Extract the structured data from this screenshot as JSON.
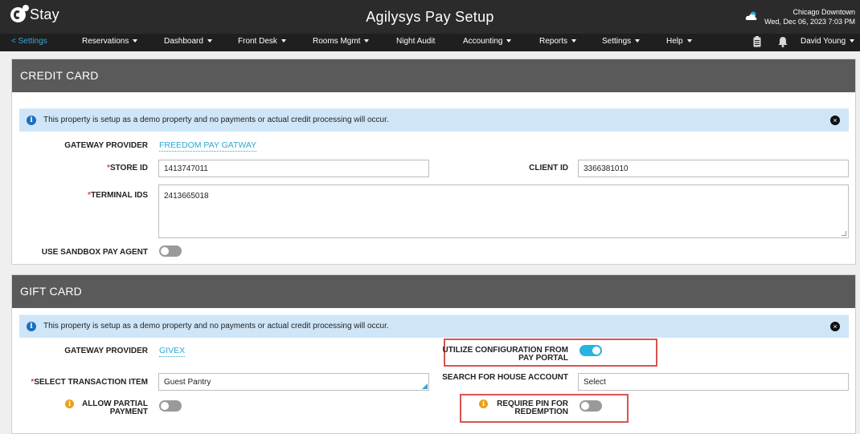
{
  "brand": {
    "logo_text": "Stay"
  },
  "header": {
    "title": "Agilysys Pay Setup",
    "location": "Chicago Downtown",
    "datetime": "Wed, Dec 06, 2023 7:03 PM"
  },
  "nav": {
    "back_label": "< Settings",
    "items": [
      {
        "label": "Reservations"
      },
      {
        "label": "Dashboard"
      },
      {
        "label": "Front Desk"
      },
      {
        "label": "Rooms Mgmt"
      },
      {
        "label": "Night Audit"
      },
      {
        "label": "Accounting"
      },
      {
        "label": "Reports"
      },
      {
        "label": "Settings"
      },
      {
        "label": "Help"
      }
    ],
    "user": "David Young"
  },
  "credit_card": {
    "title": "CREDIT CARD",
    "info": "This property is setup as a demo property and no payments or actual credit processing will occur.",
    "gateway_label": "GATEWAY PROVIDER",
    "gateway_value": "FREEDOM PAY GATWAY",
    "store_id_label": "STORE ID",
    "store_id_value": "1413747011",
    "client_id_label": "CLIENT ID",
    "client_id_value": "3366381010",
    "terminal_label": "TERMINAL IDS",
    "terminal_value": "2413665018",
    "sandbox_label": "USE SANDBOX PAY AGENT",
    "sandbox_on": false
  },
  "gift_card": {
    "title": "GIFT CARD",
    "info": "This property is setup as a demo property and no payments or actual credit processing will occur.",
    "gateway_label": "GATEWAY PROVIDER",
    "gateway_value": "GIVEX",
    "utilize_label": "UTILIZE CONFIGURATION FROM PAY PORTAL",
    "utilize_on": true,
    "transaction_label": "SELECT TRANSACTION ITEM",
    "transaction_value": "Guest Pantry",
    "house_label": "SEARCH FOR HOUSE ACCOUNT",
    "house_placeholder": "Select",
    "partial_label": "ALLOW PARTIAL PAYMENT",
    "partial_on": false,
    "pin_label": "REQUIRE PIN FOR REDEMPTION",
    "pin_on": false
  },
  "colors": {
    "accent": "#28b3e0",
    "header_bg": "#2b2b2b",
    "section_bg": "#5a5a5a",
    "highlight": "#d9534f"
  }
}
